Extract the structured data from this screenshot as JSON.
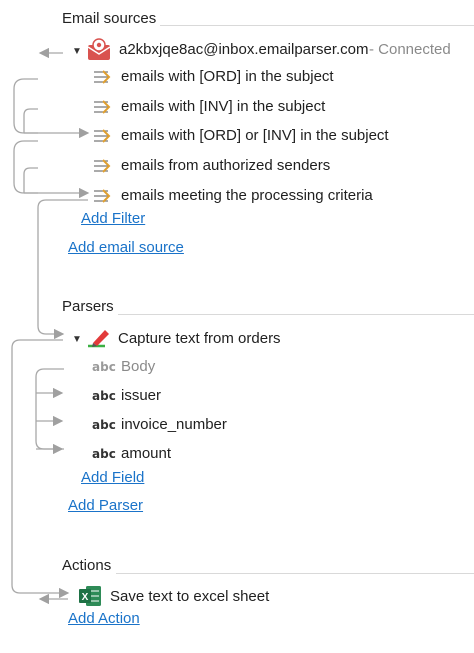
{
  "sections": {
    "email_sources": "Email sources",
    "parsers": "Parsers",
    "actions": "Actions"
  },
  "email_source": {
    "address": "a2kbxjqe8ac@inbox.emailparser.com",
    "status": "- Connected",
    "icon": "envelope-icon"
  },
  "filters": [
    {
      "label": "emails with [ORD] in the subject",
      "icon": "filter-icon"
    },
    {
      "label": "emails with [INV] in the subject",
      "icon": "filter-icon"
    },
    {
      "label": "emails with [ORD] or [INV] in the subject",
      "icon": "filter-icon"
    },
    {
      "label": "emails from authorized senders",
      "icon": "filter-icon"
    },
    {
      "label": "emails meeting the processing criteria",
      "icon": "filter-icon"
    }
  ],
  "add_filter": "Add Filter",
  "add_email_source": "Add email source",
  "parser": {
    "label": "Capture text from orders",
    "icon": "highlighter-icon"
  },
  "fields": [
    {
      "type": "abc",
      "label": "Body",
      "muted": true
    },
    {
      "type": "abc",
      "label": "issuer",
      "muted": false
    },
    {
      "type": "abc",
      "label": "invoice_number",
      "muted": false
    },
    {
      "type": "abc",
      "label": "amount",
      "muted": false
    }
  ],
  "add_field": "Add Field",
  "add_parser": "Add Parser",
  "action": {
    "label": "Save text to excel sheet",
    "icon": "excel-icon",
    "icon_letter": "X"
  },
  "add_action": "Add Action",
  "colors": {
    "link": "#1a73c9",
    "connector": "#a0a0a0",
    "excel_green": "#1e7145",
    "envelope_red": "#d9534f",
    "filter_amber": "#e0a030"
  }
}
